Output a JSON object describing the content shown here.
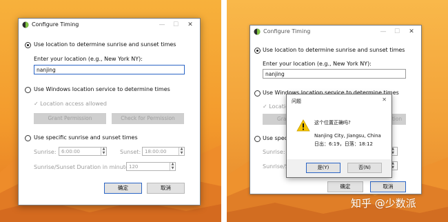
{
  "window": {
    "title": "Configure Timing",
    "minimize": "—",
    "maximize": "☐",
    "close": "✕"
  },
  "options": {
    "use_location_label": "Use location to determine sunrise and sunset times",
    "enter_location_label": "Enter your location (e.g., New York NY):",
    "location_value": "nanjing",
    "windows_location_label": "Use Windows location service to determine times",
    "access_allowed": "✓ Location access allowed",
    "grant_permission": "Grant Permission",
    "check_permission": "Check for Permission",
    "specific_times_label": "Use specific sunrise and sunset times",
    "sunrise_label": "Sunrise:",
    "sunrise_value": "6:00:00",
    "sunset_label": "Sunset:",
    "sunset_value": "18:00:00",
    "duration_label": "Sunrise/Sunset Duration in minutes:",
    "duration_value": "120"
  },
  "buttons": {
    "ok": "确定",
    "cancel": "取消"
  },
  "right_window": {
    "partial_access": "✓ Locatio",
    "partial_grant": "Gra",
    "partial_check": "tion",
    "partial_specific": "Use specific",
    "partial_sunrise": "Sunrise:",
    "partial_duration": "Sunrise/Sun"
  },
  "dialog": {
    "title": "问题",
    "question": "这个位置正确吗?",
    "city": "Nanjing City, Jiangsu, China",
    "times": "日出：6:19，日落：18:12",
    "yes": "是(Y)",
    "no": "否(N)",
    "close": "✕"
  },
  "watermark": "知乎 @少数派",
  "colors": {
    "accent": "#2a64c5",
    "bg_orange": "#f39a2c",
    "mountain_dark": "#d8681f"
  }
}
